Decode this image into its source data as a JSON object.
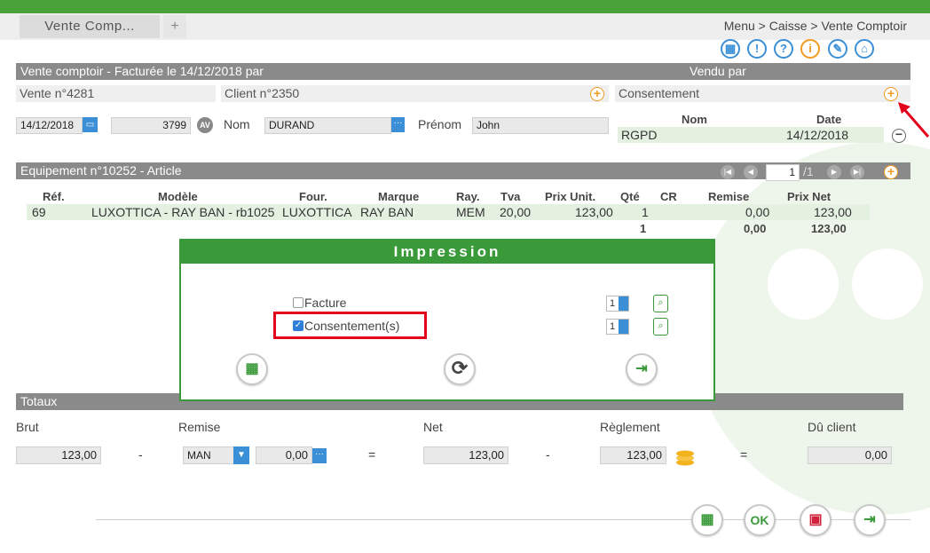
{
  "tabs": {
    "active": "Vente Comp...",
    "add": "+"
  },
  "breadcrumb": "Menu > Caisse > Vente Comptoir",
  "toolbar_icons": [
    "calendar-icon",
    "alert-icon",
    "help-icon",
    "info-icon",
    "tools-icon",
    "home-icon"
  ],
  "vente": {
    "header": "Vente comptoir - Facturée le 14/12/2018 par",
    "vendu_par": "Vendu par",
    "numero": "Vente n°4281",
    "client": "Client n°2350",
    "date": "14/12/2018",
    "code": "3799",
    "av": "AV",
    "nom_label": "Nom",
    "nom": "DURAND",
    "prenom_label": "Prénom",
    "prenom": "John"
  },
  "consentement": {
    "label": "Consentement",
    "col_nom": "Nom",
    "col_date": "Date",
    "row_nom": "RGPD",
    "row_date": "14/12/2018"
  },
  "equipement": {
    "header": "Equipement n°10252 - Article",
    "page": "1",
    "page_total": "/1",
    "columns": [
      "Réf.",
      "Modèle",
      "Four.",
      "Marque",
      "Ray.",
      "Tva",
      "Prix Unit.",
      "Qté",
      "CR",
      "Remise",
      "Prix Net"
    ],
    "row": {
      "ref": "69",
      "modele": "LUXOTTICA - RAY BAN - rb1025",
      "four": "LUXOTTICA",
      "marque": "RAY BAN",
      "ray": "MEM",
      "tva": "20,00",
      "prix": "123,00",
      "qte": "1",
      "remise": "0,00",
      "net": "123,00"
    },
    "totals": {
      "qte": "1",
      "remise": "0,00",
      "net": "123,00"
    }
  },
  "modal": {
    "title": "Impression",
    "facture_label": "Facture",
    "facture_checked": false,
    "facture_qty": "1",
    "consent_label": "Consentement(s)",
    "consent_checked": true,
    "consent_qty": "1",
    "highlight_color": "#e3001b"
  },
  "totaux": {
    "header": "Totaux",
    "brut_label": "Brut",
    "brut": "123,00",
    "remise_label": "Remise",
    "remise_type": "MAN",
    "remise": "0,00",
    "net_label": "Net",
    "net": "123,00",
    "reglement_label": "Règlement",
    "reglement": "123,00",
    "du_label": "Dû client",
    "du": "0,00",
    "minus": "-",
    "equals": "="
  },
  "footer_buttons": [
    "print-button",
    "ok-button",
    "save-button",
    "exit-button"
  ],
  "ok_label": "OK",
  "colors": {
    "green": "#4aa33a",
    "blue": "#3b8fd6",
    "orange": "#f29a1f",
    "red": "#e3001b"
  }
}
